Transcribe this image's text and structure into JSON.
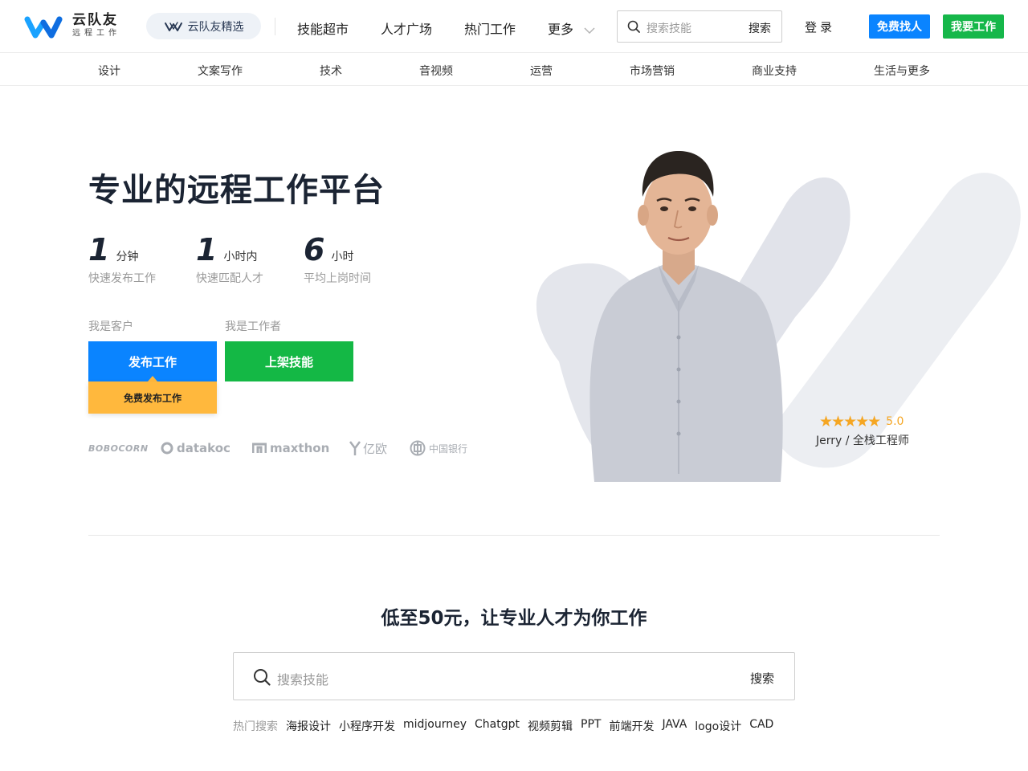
{
  "header": {
    "logo_name": "云队友",
    "logo_sub": "远程工作",
    "pill_label": "云队友精选",
    "nav": [
      "技能超市",
      "人才广场",
      "热门工作",
      "更多"
    ],
    "search_placeholder": "搜索技能",
    "search_button": "搜索",
    "login": "登录",
    "hire_button": "免费找人",
    "work_button": "我要工作"
  },
  "categories": [
    "设计",
    "文案写作",
    "技术",
    "音视频",
    "运营",
    "市场营销",
    "商业支持",
    "生活与更多"
  ],
  "hero": {
    "title": "专业的远程工作平台",
    "stats": [
      {
        "num": "1",
        "unit": "分钟",
        "desc": "快速发布工作"
      },
      {
        "num": "1",
        "unit": "小时内",
        "desc": "快速匹配人才"
      },
      {
        "num": "6",
        "unit": "小时",
        "desc": "平均上岗时间"
      }
    ],
    "client_label": "我是客户",
    "worker_label": "我是工作者",
    "post_button": "发布工作",
    "skill_button": "上架技能",
    "tip": "免费发布工作",
    "partners": [
      "BOBOCORN",
      "datakoc",
      "maxthon",
      "亿欧",
      "中国银行"
    ],
    "rating": "5.0",
    "person_caption": "Jerry / 全栈工程师"
  },
  "bottom": {
    "title": "低至50元，让专业人才为你工作",
    "search_placeholder": "搜索技能",
    "search_button": "搜索",
    "hot_label": "热门搜索",
    "hot_items": [
      "海报设计",
      "小程序开发",
      "midjourney",
      "Chatgpt",
      "视频剪辑",
      "PPT",
      "前端开发",
      "JAVA",
      "logo设计",
      "CAD"
    ]
  },
  "colors": {
    "primary_blue": "#0a84ff",
    "primary_green": "#16b74a",
    "accent_orange": "#ffb83d",
    "star": "#f5a623"
  }
}
